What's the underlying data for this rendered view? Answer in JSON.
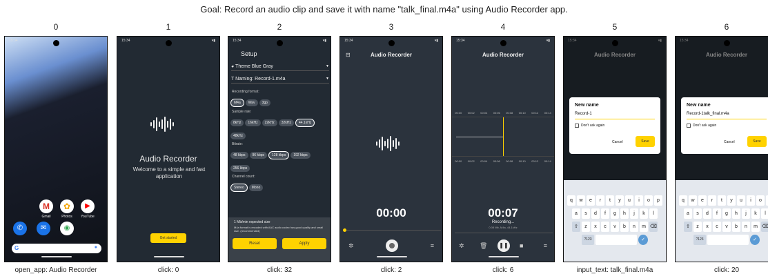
{
  "goal": "Goal: Record an audio clip and save it with name \"talk_final.m4a\" using Audio Recorder app.",
  "columns": [
    {
      "index": "0",
      "caption": "open_app: Audio Recorder"
    },
    {
      "index": "1",
      "caption": "click: 0"
    },
    {
      "index": "2",
      "caption": "click: 32"
    },
    {
      "index": "3",
      "caption": "click: 2"
    },
    {
      "index": "4",
      "caption": "click: 6"
    },
    {
      "index": "5",
      "caption": "input_text: talk_final.m4a"
    },
    {
      "index": "6",
      "caption": "click: 20"
    }
  ],
  "status": {
    "time": "15:34"
  },
  "home": {
    "apps": [
      "Gmail",
      "Photos",
      "YouTube"
    ]
  },
  "welcome": {
    "title": "Audio Recorder",
    "subtitle": "Welcome to a simple and fast application",
    "button": "Get started"
  },
  "setup": {
    "title": "Setup",
    "theme": "Theme Blue Gray",
    "naming": "Naming: Record-1.m4a",
    "recording_format_label": "Recording format:",
    "formats": [
      "M4a",
      "Wav",
      "3gp"
    ],
    "sample_rate_label": "Sample rate:",
    "rates": [
      "8kHz",
      "16kHz",
      "22kHz",
      "32kHz",
      "44.1kHz",
      "48kHz"
    ],
    "bitrate_label": "Bitrate:",
    "bitrates": [
      "48 kbps",
      "96 kbps",
      "128 kbps",
      "192 kbps",
      "256 kbps"
    ],
    "channel_label": "Channel count:",
    "channels": [
      "Stereo",
      "Mono"
    ],
    "expected": "1 Mb/min expected size",
    "info": "M4a format is encoded with AAC audio codec has good quality and small size. (recommended)",
    "reset": "Reset",
    "apply": "Apply"
  },
  "recorder": {
    "title": "Audio Recorder",
    "time_idle": "00:00",
    "time_rec": "00:07",
    "recording": "Recording...",
    "meta": "0.08 Mb, M4a, 44.1kHz",
    "ticks": [
      "00:00",
      "00:02",
      "00:04",
      "00:06",
      "00:08",
      "00:10",
      "00:12",
      "00:14"
    ]
  },
  "dialog": {
    "title": "New name",
    "value_before": "Record-1",
    "value_after": "Record-1talk_final.m4a",
    "checkbox": "Don't ask again",
    "cancel": "Cancel",
    "save": "Save"
  },
  "keyboard": {
    "row1": [
      "q",
      "w",
      "e",
      "r",
      "t",
      "y",
      "u",
      "i",
      "o",
      "p"
    ],
    "row2": [
      "a",
      "s",
      "d",
      "f",
      "g",
      "h",
      "j",
      "k",
      "l"
    ],
    "row3": [
      "z",
      "x",
      "c",
      "v",
      "b",
      "n",
      "m"
    ],
    "sym": "?123"
  }
}
